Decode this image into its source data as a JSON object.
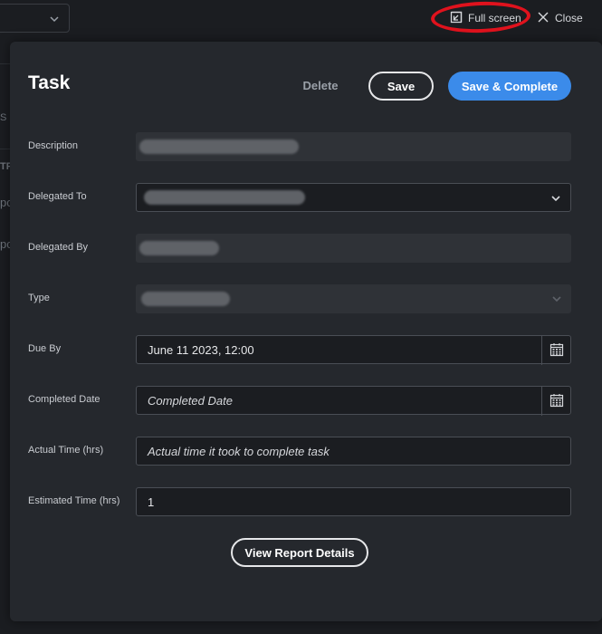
{
  "background": {
    "fragments": [
      "S",
      "TP",
      "pc",
      "pc"
    ]
  },
  "topbar": {
    "fullscreen_label": "Full screen",
    "close_label": "Close"
  },
  "modal": {
    "title": "Task",
    "delete_label": "Delete",
    "save_label": "Save",
    "save_complete_label": "Save & Complete",
    "report_label": "View Report Details"
  },
  "fields": {
    "description": {
      "label": "Description"
    },
    "delegated_to": {
      "label": "Delegated To"
    },
    "delegated_by": {
      "label": "Delegated By"
    },
    "type": {
      "label": "Type"
    },
    "due_by": {
      "label": "Due By",
      "value": "June 11 2023, 12:00"
    },
    "completed_date": {
      "label": "Completed Date",
      "placeholder": "Completed Date"
    },
    "actual_time": {
      "label": "Actual Time (hrs)",
      "placeholder": "Actual time it took to complete task"
    },
    "estimated_time": {
      "label": "Estimated Time (hrs)",
      "value": "1"
    }
  },
  "colors": {
    "accent": "#3b8bea",
    "annotation": "#e0121d"
  }
}
